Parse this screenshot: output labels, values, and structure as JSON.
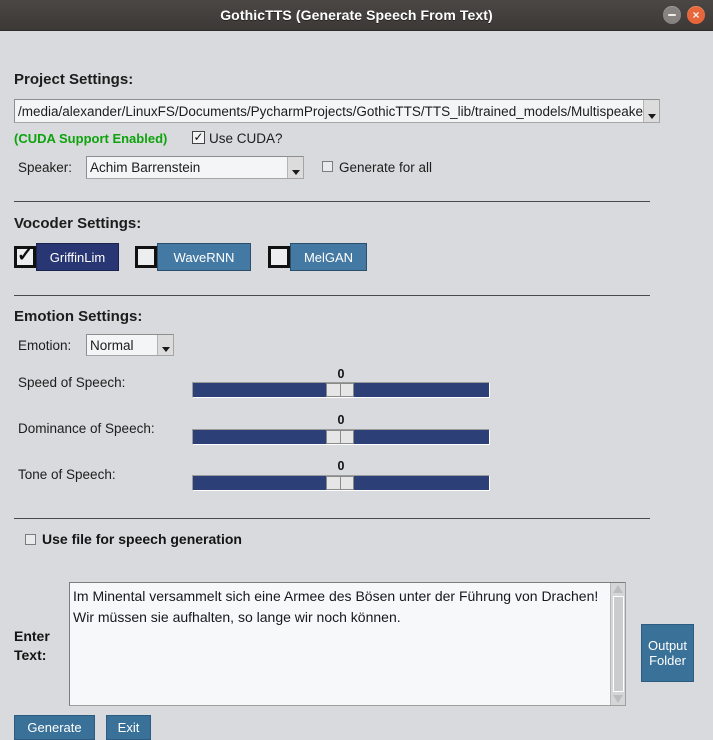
{
  "window": {
    "title": "GothicTTS (Generate Speech From Text)",
    "minimize_label": "minimize",
    "close_label": "×"
  },
  "project_settings": {
    "heading": "Project Settings:",
    "model_path": "/media/alexander/LinuxFS/Documents/PycharmProjects/GothicTTS/TTS_lib/trained_models/MultispeakerGo",
    "cuda_status": "(CUDA Support Enabled)",
    "use_cuda_label": "Use CUDA?",
    "use_cuda_checked": true,
    "speaker_label": "Speaker:",
    "speaker_value": "Achim Barrenstein",
    "generate_for_all_label": "Generate for all",
    "generate_for_all_checked": false
  },
  "vocoder_settings": {
    "heading": "Vocoder Settings:",
    "options": [
      {
        "label": "GriffinLim",
        "checked": true,
        "color": "#283673"
      },
      {
        "label": "WaveRNN",
        "checked": false,
        "color": "#4379a3"
      },
      {
        "label": "MelGAN",
        "checked": false,
        "color": "#4379a3"
      }
    ]
  },
  "emotion_settings": {
    "heading": "Emotion Settings:",
    "emotion_label": "Emotion:",
    "emotion_value": "Normal",
    "sliders": [
      {
        "label": "Speed of Speech:",
        "value": "0"
      },
      {
        "label": "Dominance of Speech:",
        "value": "0"
      },
      {
        "label": "Tone of Speech:",
        "value": "0"
      }
    ]
  },
  "file_option": {
    "label": "Use file for speech generation",
    "checked": false
  },
  "text_input": {
    "label_line1": "Enter",
    "label_line2": "Text:",
    "value": "Im Minental versammelt sich eine Armee des Bösen unter der Führung von Drachen! Wir müssen sie aufhalten, so lange wir noch können."
  },
  "actions": {
    "output_folder_line1": "Output",
    "output_folder_line2": "Folder",
    "generate_label": "Generate",
    "exit_label": "Exit"
  }
}
